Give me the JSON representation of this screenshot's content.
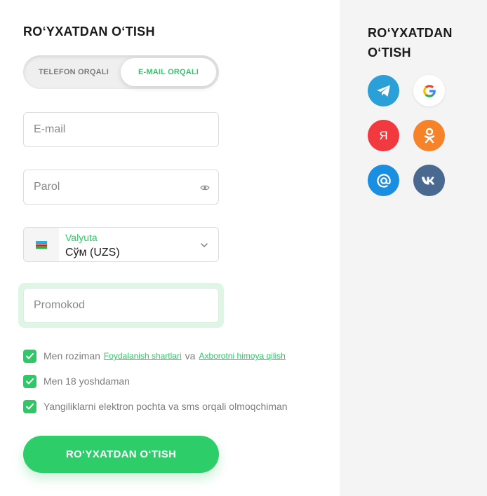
{
  "form": {
    "title": "RO‘YXATDAN O‘TISH",
    "tabs": [
      {
        "label": "TELEFON ORQALI",
        "active": false
      },
      {
        "label": "E-MAIL ORQALI",
        "active": true
      }
    ],
    "email_placeholder": "E-mail",
    "password_placeholder": "Parol",
    "currency": {
      "label": "Valyuta",
      "value": "Сўм (UZS)"
    },
    "promo_placeholder": "Promokod",
    "checkboxes": [
      {
        "checked": true,
        "text_before": "Men roziman",
        "link1": "Foydalanish shartlari",
        "joiner": "va",
        "link2": "Axborotni himoya qilish"
      },
      {
        "checked": true,
        "text": "Men 18 yoshdaman"
      },
      {
        "checked": true,
        "text": "Yangiliklarni elektron pochta va sms orqali olmoqchiman"
      }
    ],
    "submit_label": "RO‘YXATDAN O‘TISH"
  },
  "social": {
    "title": "RO‘YXATDAN O‘TISH",
    "providers": [
      {
        "name": "telegram-icon",
        "color": "#2a9fd8"
      },
      {
        "name": "google-icon",
        "color": "#ffffff"
      },
      {
        "name": "yandex-icon",
        "color": "#f2393f",
        "glyph": "Я"
      },
      {
        "name": "odnoklassniki-icon",
        "color": "#f6822a"
      },
      {
        "name": "mail-icon",
        "color": "#1a8ee0",
        "glyph": "@"
      },
      {
        "name": "vk-icon",
        "color": "#4a6990"
      }
    ]
  },
  "colors": {
    "accent": "#2ec866",
    "sidebar_bg": "#f4f4f5"
  }
}
